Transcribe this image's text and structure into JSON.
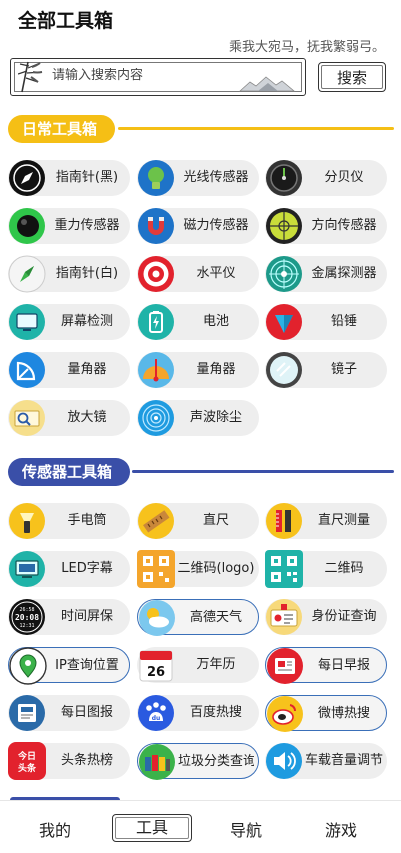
{
  "header": {
    "title": "全部工具箱",
    "slogan": "乘我大宛马，抚我繁弱弓。"
  },
  "search": {
    "placeholder": "请输入搜索内容",
    "button_label": "搜索"
  },
  "sections": [
    {
      "title": "日常工具箱",
      "tools": [
        {
          "label": "指南针(黑)",
          "icon": "compass-black-icon"
        },
        {
          "label": "光线传感器",
          "icon": "light-bulb-icon"
        },
        {
          "label": "分贝仪",
          "icon": "decibel-meter-icon"
        },
        {
          "label": "重力传感器",
          "icon": "gravity-ball-icon"
        },
        {
          "label": "磁力传感器",
          "icon": "magnet-icon"
        },
        {
          "label": "方向传感器",
          "icon": "crosshair-icon"
        },
        {
          "label": "指南针(白)",
          "icon": "compass-white-icon"
        },
        {
          "label": "水平仪",
          "icon": "target-icon"
        },
        {
          "label": "金属探测器",
          "icon": "radar-icon"
        },
        {
          "label": "屏幕检测",
          "icon": "monitor-icon"
        },
        {
          "label": "电池",
          "icon": "battery-icon"
        },
        {
          "label": "铅锤",
          "icon": "plumb-bob-icon"
        },
        {
          "label": "量角器",
          "icon": "protractor-icon"
        },
        {
          "label": "量角器",
          "icon": "protractor-orange-icon"
        },
        {
          "label": "镜子",
          "icon": "mirror-icon"
        },
        {
          "label": "放大镜",
          "icon": "magnifier-icon"
        },
        {
          "label": "声波除尘",
          "icon": "sound-wave-icon"
        }
      ]
    },
    {
      "title": "传感器工具箱",
      "tools": [
        {
          "label": "手电筒",
          "icon": "flashlight-icon"
        },
        {
          "label": "直尺",
          "icon": "ruler-icon"
        },
        {
          "label": "直尺测量",
          "icon": "ruler-measure-icon"
        },
        {
          "label": "LED字幕",
          "icon": "led-screen-icon"
        },
        {
          "label": "二维码(logo)",
          "icon": "qrcode-logo-icon"
        },
        {
          "label": "二维码",
          "icon": "qrcode-icon"
        },
        {
          "label": "时间屏保",
          "icon": "clock-screen-icon"
        },
        {
          "label": "高德天气",
          "icon": "weather-icon"
        },
        {
          "label": "身份证查询",
          "icon": "id-card-icon"
        },
        {
          "label": "IP查询位置",
          "icon": "location-pin-icon"
        },
        {
          "label": "万年历",
          "icon": "calendar-icon"
        },
        {
          "label": "每日早报",
          "icon": "newspaper-icon"
        },
        {
          "label": "每日图报",
          "icon": "picture-news-icon"
        },
        {
          "label": "百度热搜",
          "icon": "baidu-icon"
        },
        {
          "label": "微博热搜",
          "icon": "weibo-icon"
        },
        {
          "label": "头条热榜",
          "icon": "toutiao-icon",
          "icon_text": "今日头条"
        },
        {
          "label": "垃圾分类查询",
          "icon": "trash-sort-icon"
        },
        {
          "label": "车载音量调节",
          "icon": "speaker-icon"
        }
      ]
    }
  ],
  "calendar_icon_text": "26",
  "clock_icon_text": [
    "26:58",
    "20:08",
    "12:31"
  ],
  "bottom_nav": [
    {
      "label": "我的",
      "active": false
    },
    {
      "label": "工具",
      "active": true
    },
    {
      "label": "导航",
      "active": false
    },
    {
      "label": "游戏",
      "active": false
    }
  ]
}
